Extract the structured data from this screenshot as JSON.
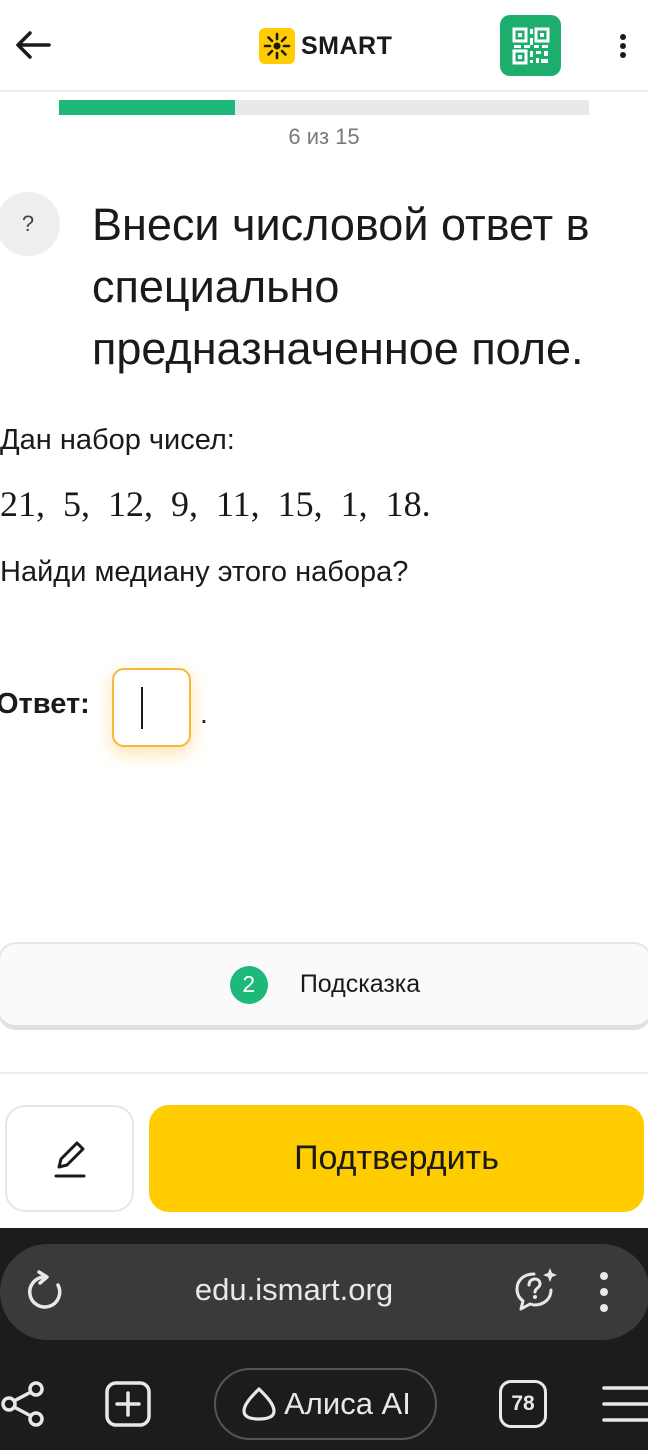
{
  "header": {
    "logo_text": "SMART",
    "brand_color": "#FFCC00",
    "qr_color": "#1DAE6E"
  },
  "progress": {
    "current": 6,
    "total": 15,
    "fraction": 0.333,
    "text": "6 из 15"
  },
  "question": {
    "badge": "?",
    "title": "Внеси числовой ответ в специально предназначенное поле."
  },
  "task": {
    "line1": "Дан набор чисел:",
    "numbers": "21,  5,  12,  9,  11,  15,  1,  18.",
    "line2": "Найди медиану этого набора?"
  },
  "answer": {
    "label": "Ответ:",
    "value": "",
    "suffix": "."
  },
  "hint": {
    "count": "2",
    "label": "Подсказка"
  },
  "actions": {
    "confirm_label": "Подтвердить"
  },
  "browser": {
    "url": "edu.ismart.org",
    "alice_label": "Алиса AI",
    "tab_count": "78"
  }
}
